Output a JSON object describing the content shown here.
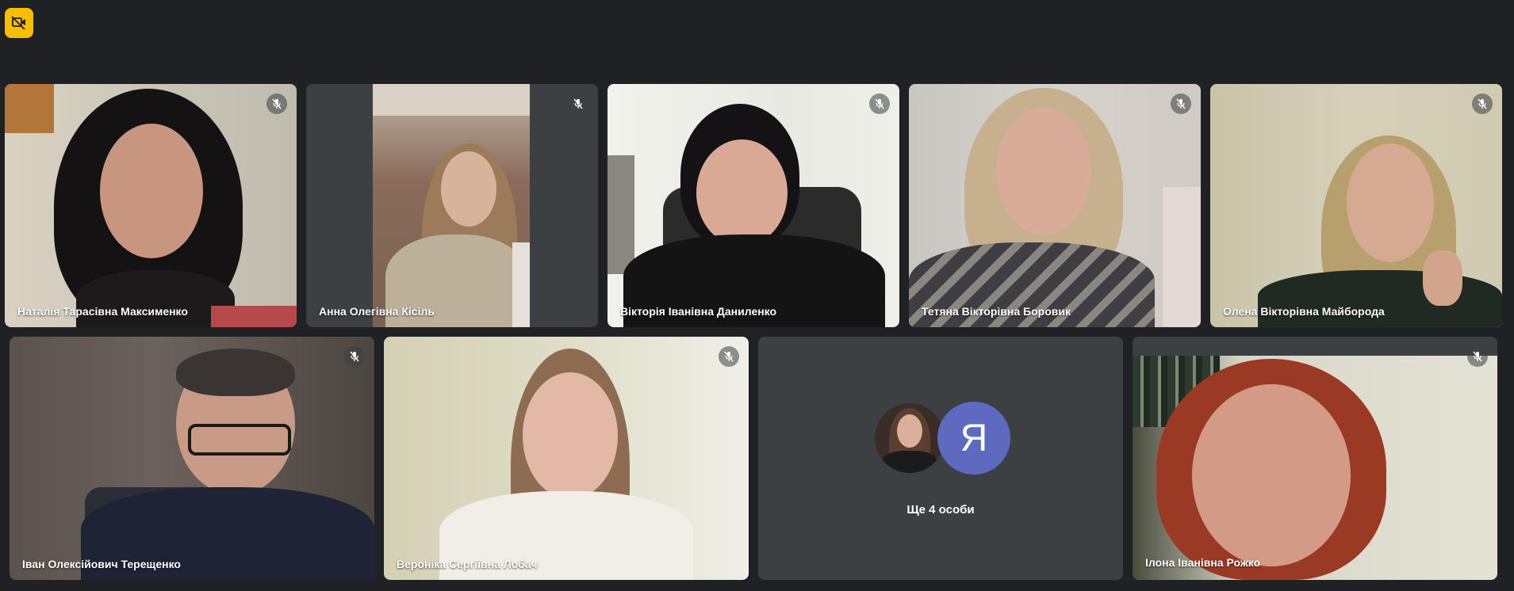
{
  "top_badge": {
    "icon": "camera-off-icon",
    "color": "#fbbc04"
  },
  "participants": [
    {
      "name": "Наталія Тарасівна Максименко",
      "mic": "mic-off-icon"
    },
    {
      "name": "Анна Олегівна Кісіль",
      "mic": "mic-off-icon"
    },
    {
      "name": "Вікторія Іванівна Даниленко",
      "mic": "mic-off-icon"
    },
    {
      "name": "Тетяна Вікторівна Боровик",
      "mic": "mic-off-icon"
    },
    {
      "name": "Олена Вікторівна Майборода",
      "mic": "mic-off-icon"
    },
    {
      "name": "Іван Олексійович Терещенко",
      "mic": "mic-off-icon"
    },
    {
      "name": "Вероніка Сергіївна Лобач",
      "mic": "mic-off-icon"
    },
    {
      "name": "Ілона Іванівна Рожко",
      "mic": "mic-off-icon"
    }
  ],
  "more_tile": {
    "avatar_letter": "Я",
    "label": "Ще 4 особи",
    "avatar_color": "#5c6bc0"
  },
  "colors": {
    "background": "#202124",
    "tile": "#3c4043"
  }
}
